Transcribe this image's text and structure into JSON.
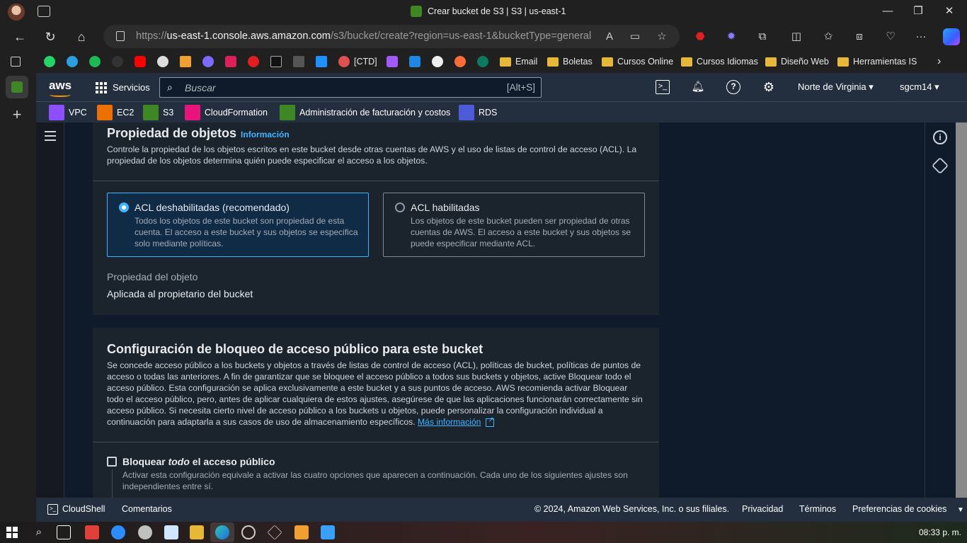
{
  "browser": {
    "tab_title": "Crear bucket de S3 | S3 | us-east-1",
    "url_prefix": "https://",
    "url_host": "us-east-1.console.aws.amazon.com",
    "url_path": "/s3/bucket/create?region=us-east-1&bucketType=general",
    "favorites": [
      {
        "label": "[CTD]"
      },
      {
        "label": "Email"
      },
      {
        "label": "Boletas"
      },
      {
        "label": "Cursos Online"
      },
      {
        "label": "Cursos Idiomas"
      },
      {
        "label": "Diseño Web"
      },
      {
        "label": "Herramientas IS"
      }
    ]
  },
  "aws": {
    "logo": "aws",
    "services_label": "Servicios",
    "search_placeholder": "Buscar",
    "search_shortcut": "[Alt+S]",
    "region": "Norte de Virginia",
    "user": "sgcm14",
    "pinned": [
      {
        "label": "VPC",
        "color": "#8c4fff"
      },
      {
        "label": "EC2",
        "color": "#ed7100"
      },
      {
        "label": "S3",
        "color": "#3f8624"
      },
      {
        "label": "CloudFormation",
        "color": "#e7157b"
      },
      {
        "label": "Administración de facturación y costos",
        "color": "#3f8624"
      },
      {
        "label": "RDS",
        "color": "#4d5bd9"
      }
    ]
  },
  "ownership": {
    "title": "Propiedad de objetos",
    "info": "Información",
    "description": "Controle la propiedad de los objetos escritos en este bucket desde otras cuentas de AWS y el uso de listas de control de acceso (ACL). La propiedad de los objetos determina quién puede especificar el acceso a los objetos.",
    "options": [
      {
        "title": "ACL deshabilitadas (recomendado)",
        "description": "Todos los objetos de este bucket son propiedad de esta cuenta. El acceso a este bucket y sus objetos se especifica solo mediante políticas.",
        "selected": true
      },
      {
        "title": "ACL habilitadas",
        "description": "Los objetos de este bucket pueden ser propiedad de otras cuentas de AWS. El acceso a este bucket y sus objetos se puede especificar mediante ACL.",
        "selected": false
      }
    ],
    "field_label": "Propiedad del objeto",
    "field_value": "Aplicada al propietario del bucket"
  },
  "public_access": {
    "title": "Configuración de bloqueo de acceso público para este bucket",
    "description": "Se concede acceso público a los buckets y objetos a través de listas de control de acceso (ACL), políticas de bucket, políticas de puntos de acceso o todas las anteriores. A fin de garantizar que se bloquee el acceso público a todos sus buckets y objetos, active Bloquear todo el acceso público. Esta configuración se aplica exclusivamente a este bucket y a sus puntos de acceso. AWS recomienda activar Bloquear todo el acceso público, pero, antes de aplicar cualquiera de estos ajustes, asegúrese de que las aplicaciones funcionarán correctamente sin acceso público. Si necesita cierto nivel de acceso público a los buckets u objetos, puede personalizar la configuración individual a continuación para adaptarla a sus casos de uso de almacenamiento específicos.",
    "learn_more": "Más información",
    "block_all_pre": "Bloquear ",
    "block_all_em": "todo",
    "block_all_post": " el acceso público",
    "block_all_desc": "Activar esta configuración equivale a activar las cuatro opciones que aparecen a continuación. Cada uno de los siguientes ajustes son independientes entre sí.",
    "block_all_checked": false
  },
  "footer": {
    "cloudshell": "CloudShell",
    "comments": "Comentarios",
    "copyright": "© 2024, Amazon Web Services, Inc. o sus filiales.",
    "privacy": "Privacidad",
    "terms": "Términos",
    "cookies": "Preferencias de cookies"
  },
  "taskbar": {
    "time": "08:33 p. m."
  }
}
